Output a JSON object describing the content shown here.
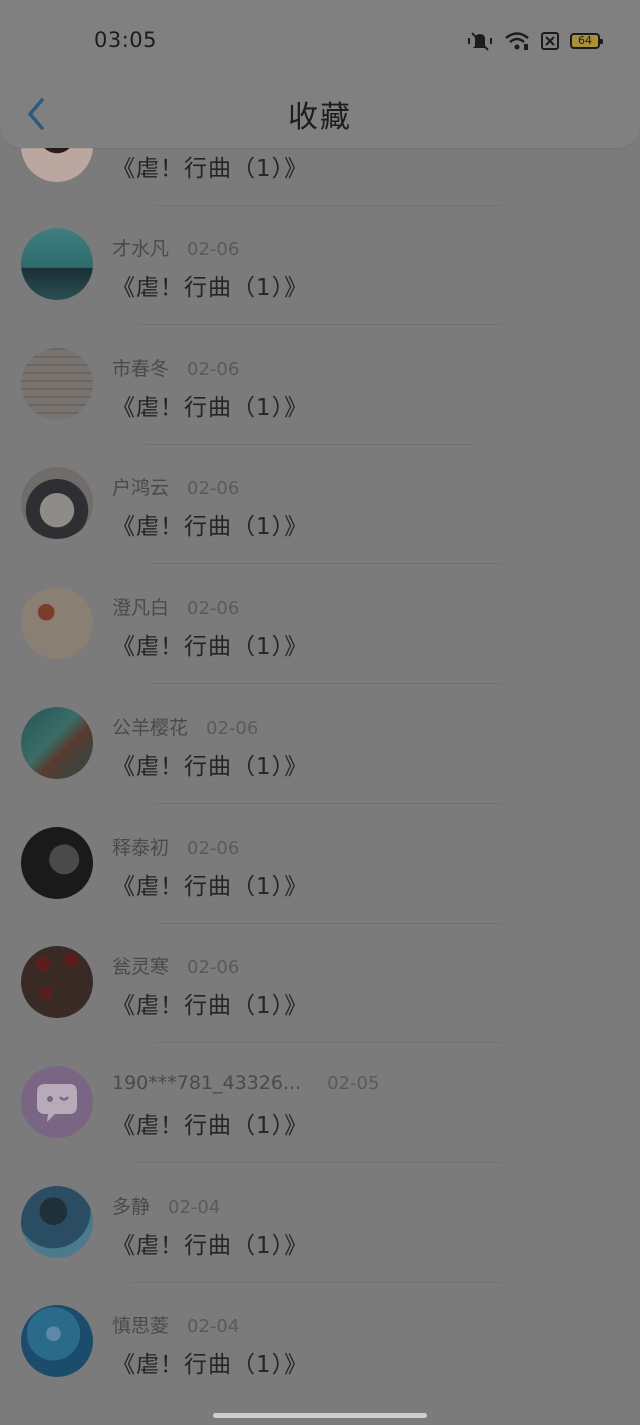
{
  "status_bar": {
    "time": "03:05",
    "battery": "64"
  },
  "header": {
    "title": "收藏",
    "back_icon": "chevron-left-icon"
  },
  "rows": [
    {
      "name": "",
      "date": "",
      "message": "《虐！行曲（1）》",
      "avatar_colors": [
        "#2c1b1b",
        "#b9a7a0"
      ]
    },
    {
      "name": "才水凡",
      "date": "02-06",
      "message": "《虐！行曲（1）》",
      "avatar_colors": [
        "#2e6b6c",
        "#1a2f35"
      ]
    },
    {
      "name": "市春冬",
      "date": "02-06",
      "message": "《虐！行曲（1）》",
      "avatar_colors": [
        "#7a7471",
        "#6c6662"
      ]
    },
    {
      "name": "户鸿云",
      "date": "02-06",
      "message": "《虐！行曲（1）》",
      "avatar_colors": [
        "#6f6c6a",
        "#2f2f33"
      ]
    },
    {
      "name": "澄凡白",
      "date": "02-06",
      "message": "《虐！行曲（1）》",
      "avatar_colors": [
        "#8a7f73",
        "#7a3d2a"
      ]
    },
    {
      "name": "公羊樱花",
      "date": "02-06",
      "message": "《虐！行曲（1）》",
      "avatar_colors": [
        "#275654",
        "#5a3b2e"
      ]
    },
    {
      "name": "释泰初",
      "date": "02-06",
      "message": "《虐！行曲（1）》",
      "avatar_colors": [
        "#1a1a1a",
        "#4a4a4a"
      ]
    },
    {
      "name": "瓮灵寒",
      "date": "02-06",
      "message": "《虐！行曲（1）》",
      "avatar_colors": [
        "#3a2a26",
        "#5c1d1d"
      ]
    },
    {
      "name": "190***781_43326...",
      "date": "02-05",
      "message": "《虐！行曲（1）》",
      "avatar_colors": [
        "#7b6584",
        "#8d7896"
      ]
    },
    {
      "name": "多静",
      "date": "02-04",
      "message": "《虐！行曲（1）》",
      "avatar_colors": [
        "#2a4d63",
        "#1f3038"
      ]
    },
    {
      "name": "慎思菱",
      "date": "02-04",
      "message": "《虐！行曲（1）》",
      "avatar_colors": [
        "#1c4c6b",
        "#2a6b8c"
      ]
    }
  ]
}
